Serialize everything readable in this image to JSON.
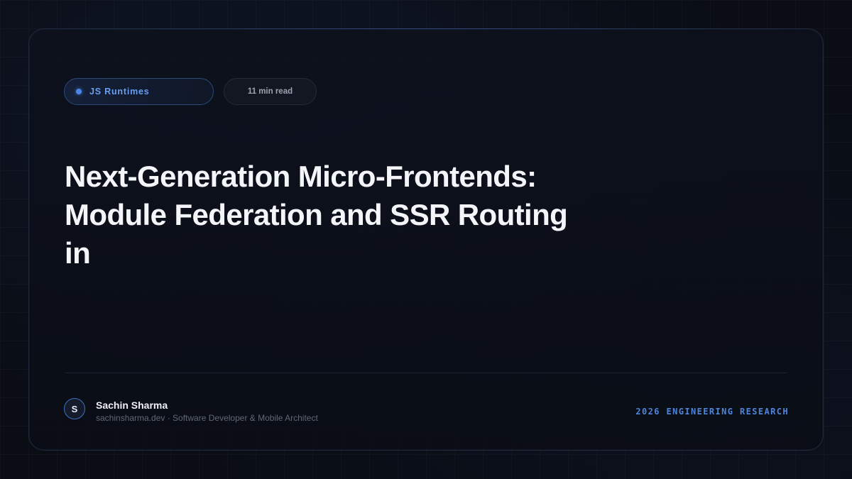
{
  "card": {
    "category": {
      "label": "JS Runtimes"
    },
    "read_time": "11 min read",
    "title_lines": [
      "Next-Generation Micro-Frontends:",
      "Module Federation and SSR Routing",
      "in"
    ],
    "author": {
      "initial": "S",
      "name": "Sachin Sharma",
      "meta": "sachinsharma.dev · Software Developer & Mobile Architect"
    },
    "footer_tag": "2026 ENGINEERING RESEARCH"
  },
  "colors": {
    "background": "#0a0d14",
    "accent": "#4a86e8",
    "title": "#f3f5f9",
    "muted": "#5e6878"
  }
}
